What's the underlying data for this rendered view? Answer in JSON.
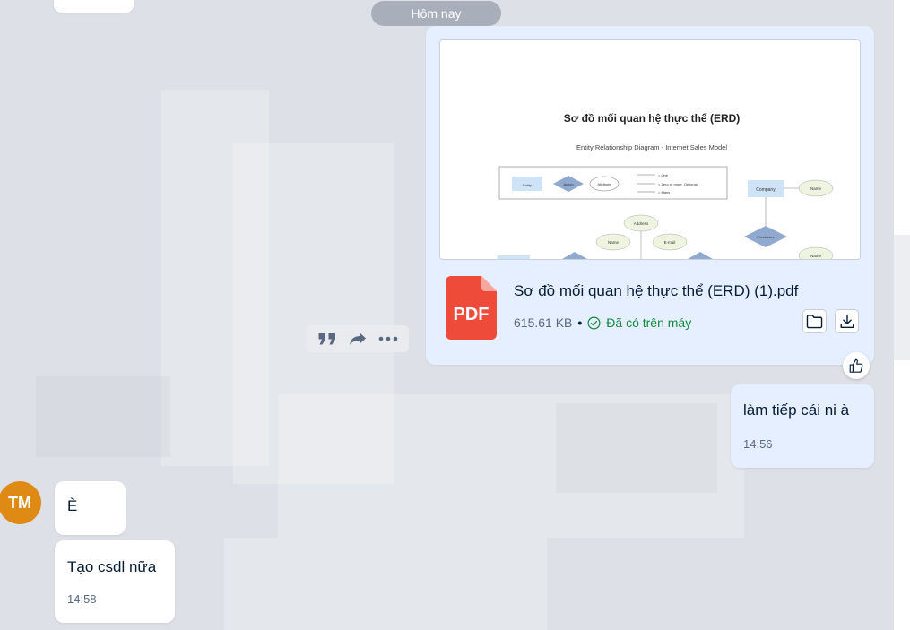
{
  "date_divider": "Hôm nay",
  "file_message": {
    "preview": {
      "title": "Sơ đồ mối quan hệ thực thể (ERD)",
      "subtitle": "Entity Relationship Diagram - Internet Sales Model",
      "legend": [
        "Entity",
        "Action",
        "Attribute"
      ],
      "legend_lines": [
        "= One",
        "= Zero or more, Optional",
        "= Many"
      ],
      "nodes": [
        "Company",
        "Name",
        "Address",
        "Name",
        "E-mail",
        "Purchases",
        "Name"
      ]
    },
    "file_type": "PDF",
    "file_name": "Sơ đồ mối quan hệ thực thể (ERD) (1).pdf",
    "file_size": "615.61 KB",
    "status": "Đã có trên máy",
    "open_folder_icon": "folder-icon",
    "download_icon": "download-icon"
  },
  "action_bar": {
    "icons": [
      "quote-icon",
      "forward-icon",
      "more-icon"
    ]
  },
  "reaction_icon": "thumbs-up-icon",
  "messages": [
    {
      "sender": "me",
      "text": "làm tiếp cái ni à",
      "time": "14:56"
    },
    {
      "sender": "TM",
      "text": "È"
    },
    {
      "sender": "TM",
      "text": "Tạo csdl nữa",
      "time": "14:58"
    }
  ],
  "contact": {
    "initials": "TM",
    "avatar_color": "#e08a16"
  },
  "colors": {
    "my_bubble": "#e5efff",
    "their_bubble": "#ffffff",
    "background": "#dde0e6",
    "pdf_red": "#ee4b3a",
    "success_green": "#14883e"
  }
}
